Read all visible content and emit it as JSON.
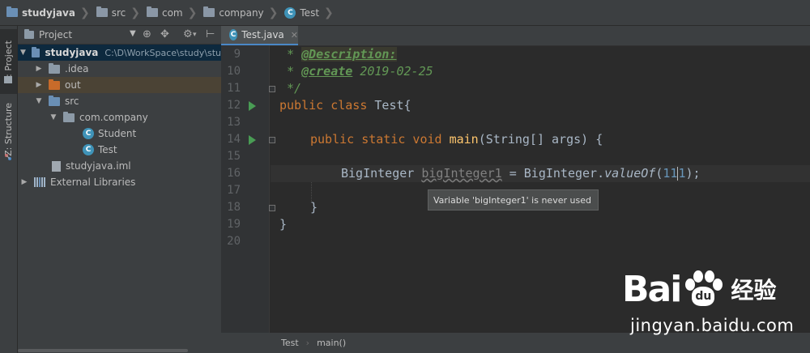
{
  "breadcrumb": [
    {
      "label": "studyjava",
      "icon": "module-folder-icon",
      "bold": true
    },
    {
      "label": "src",
      "icon": "folder-icon"
    },
    {
      "label": "com",
      "icon": "folder-icon"
    },
    {
      "label": "company",
      "icon": "folder-icon"
    },
    {
      "label": "Test",
      "icon": "class-icon"
    }
  ],
  "left_toolbar": {
    "project_tab": "1: Project",
    "structure_tab": "Z: Structure"
  },
  "project_panel": {
    "title": "Project",
    "tree": [
      {
        "label": "studyjava",
        "path": "C:\\D\\WorkSpace\\study\\stu",
        "expanded": true
      },
      {
        "label": ".idea"
      },
      {
        "label": "out"
      },
      {
        "label": "src"
      },
      {
        "label": "com.company"
      },
      {
        "label": "Student"
      },
      {
        "label": "Test"
      },
      {
        "label": "studyjava.iml"
      },
      {
        "label": "External Libraries"
      }
    ]
  },
  "editor": {
    "tab_label": "Test.java",
    "line_numbers": [
      "9",
      "10",
      "11",
      "12",
      "13",
      "14",
      "15",
      "16",
      "17",
      "18",
      "19",
      "20"
    ],
    "code": {
      "l9_prefix": " * ",
      "l9_tag": "@Description:",
      "l10_prefix": " * ",
      "l10_tag": "@create",
      "l10_value": " 2019-02-25",
      "l11": " */",
      "l12_kw": "public class",
      "l12_rest": " Test{",
      "l14_kw": "public static void",
      "l14_fn": "main",
      "l14_rest": "(String[] args) {",
      "l16_type": "BigInteger ",
      "l16_var": "bigInteger1",
      "l16_mid": " = BigInteger.",
      "l16_method": "valueOf",
      "l16_open": "(",
      "l16_num_a": "11",
      "l16_num_b": "1",
      "l16_close": ");",
      "l18": "}",
      "l19": "}"
    },
    "tooltip": "Variable 'bigInteger1' is never used"
  },
  "status_breadcrumb": {
    "class": "Test",
    "method": "main()"
  },
  "watermark": {
    "brand_a": "Bai",
    "paw_text": "du",
    "brand_b": "",
    "brand_cn": "经验",
    "url": "jingyan.baidu.com"
  },
  "colors": {
    "keyword": "#cc7832",
    "comment": "#629755",
    "function": "#ffc66d",
    "number": "#6897bb",
    "run_icon": "#499c54",
    "selection": "#0d293e",
    "tab_accent": "#4a88c7"
  }
}
